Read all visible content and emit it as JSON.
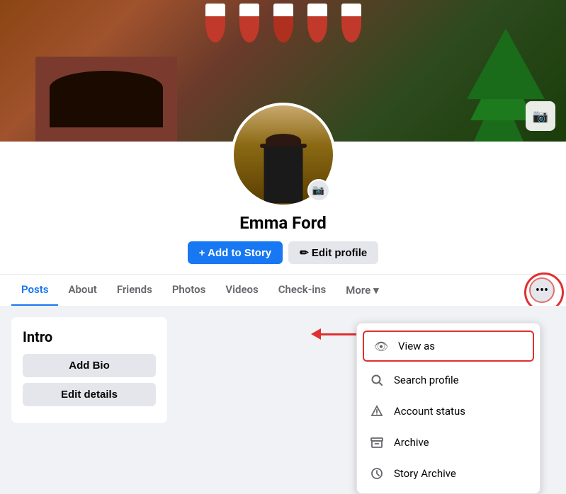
{
  "cover": {
    "camera_icon": "📷"
  },
  "profile": {
    "name": "Emma Ford",
    "camera_icon": "📷",
    "add_story_label": "+ Add to Story",
    "edit_profile_label": "✏ Edit profile"
  },
  "nav": {
    "tabs": [
      {
        "label": "Posts",
        "active": true
      },
      {
        "label": "About",
        "active": false
      },
      {
        "label": "Friends",
        "active": false
      },
      {
        "label": "Photos",
        "active": false
      },
      {
        "label": "Videos",
        "active": false
      },
      {
        "label": "Check-ins",
        "active": false
      }
    ],
    "more_label": "More",
    "dots_label": "•••"
  },
  "intro": {
    "title": "Intro",
    "add_bio_label": "Add Bio",
    "edit_details_label": "Edit details"
  },
  "dropdown": {
    "items": [
      {
        "id": "view-as",
        "icon": "👁",
        "label": "View as",
        "highlighted": true
      },
      {
        "id": "search-profile",
        "icon": "🔍",
        "label": "Search profile",
        "highlighted": false
      },
      {
        "id": "account-status",
        "icon": "⚠",
        "label": "Account status",
        "highlighted": false
      },
      {
        "id": "archive",
        "icon": "🗃",
        "label": "Archive",
        "highlighted": false
      },
      {
        "id": "story-archive",
        "icon": "🕐",
        "label": "Story Archive",
        "highlighted": false
      }
    ]
  }
}
